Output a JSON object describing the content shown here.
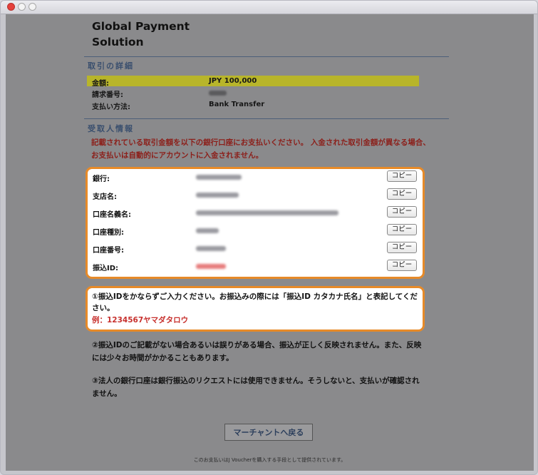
{
  "brand": {
    "title": "Global Payment Solution"
  },
  "transaction": {
    "section_title": "取引の詳細",
    "amount_label": "金額:",
    "amount_value": "JPY 100,000",
    "invoice_label": "請求番号:",
    "method_label": "支払い方法:",
    "method_value": "Bank Transfer"
  },
  "recipient": {
    "section_title": "受取人情報",
    "notice": "記載されている取引金額を以下の銀行口座にお支払いください。 入金された取引金額が異なる場合、お支払いは自動的にアカウントに入金されません。"
  },
  "bank": {
    "copy_label": "コピー",
    "rows": [
      {
        "label": "銀行:"
      },
      {
        "label": "支店名:"
      },
      {
        "label": "口座名義名:"
      },
      {
        "label": "口座種別:"
      },
      {
        "label": "口座番号:"
      },
      {
        "label": "振込ID:"
      }
    ]
  },
  "info": {
    "text": "①振込IDをかならずご入力ください。お振込みの際には「振込ID カタカナ氏名」と表記してください。",
    "example": "例：1234567ヤマダタロウ"
  },
  "notes": [
    "②振込IDのご記載がない場合あるいは誤りがある場合、振込が正しく反映されません。また、反映には少々お時間がかかることもあります。",
    "③法人の銀行口座は銀行振込のリクエストには使用できません。そうしないと、支払いが確認されません。"
  ],
  "actions": {
    "back_to_merchant": "マーチャントへ戻る"
  },
  "footer": "このお支払いはJ Voucherを購入する手段として提供されています。"
}
